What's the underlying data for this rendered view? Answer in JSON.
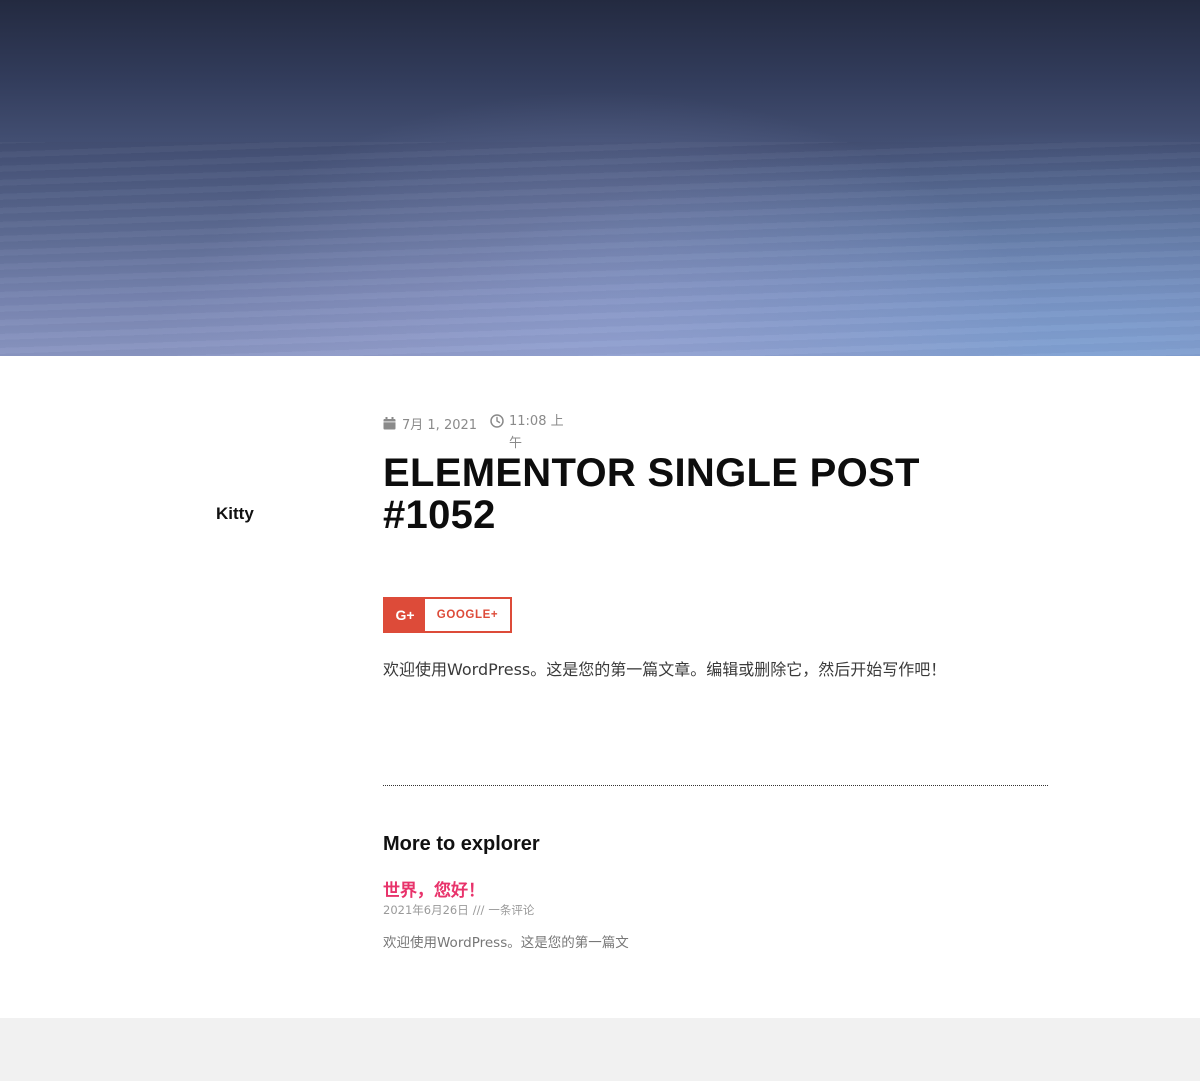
{
  "post": {
    "author": "Kitty",
    "date": "7月 1, 2021",
    "time": "11:08 上午",
    "title": "ELEMENTOR SINGLE POST #1052",
    "content": "欢迎使用WordPress。这是您的第一篇文章。编辑或删除它，然后开始写作吧！"
  },
  "share": {
    "icon_text": "G+",
    "label": "GOOGLE+"
  },
  "related": {
    "heading": "More to explorer",
    "items": [
      {
        "title": "世界，您好！",
        "date": "2021年6月26日",
        "separator": "///",
        "comments": "一条评论",
        "excerpt": "欢迎使用WordPress。这是您的第一篇文"
      }
    ]
  },
  "colors": {
    "accent": "#e8336b",
    "google_red": "#dd4b39",
    "footer_bg": "#f1f1f1"
  },
  "icons": {
    "date": "calendar-icon",
    "time": "clock-icon"
  }
}
